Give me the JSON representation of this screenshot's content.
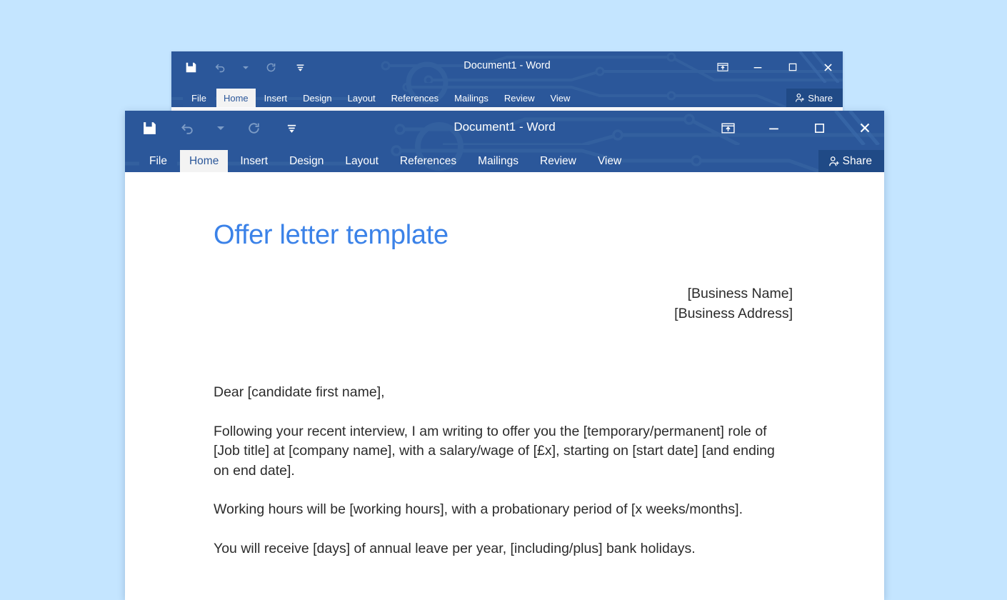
{
  "desktop": {
    "background_color": "#c4e5ff"
  },
  "theme": {
    "titlebar_color": "#2b579a",
    "active_tab_bg": "#f3f3f3",
    "active_tab_text": "#2b579a",
    "share_button_bg": "#204a86",
    "heading_color": "#3b82e8",
    "body_text_color": "#2b2b2b"
  },
  "back_window": {
    "title": "Document1 - Word",
    "quick_access": [
      {
        "name": "save-icon",
        "label": "Save",
        "enabled": true
      },
      {
        "name": "undo-icon",
        "label": "Undo",
        "enabled": false
      },
      {
        "name": "undo-dropdown-icon",
        "label": "Undo options",
        "enabled": false
      },
      {
        "name": "redo-icon",
        "label": "Redo",
        "enabled": false
      },
      {
        "name": "customize-quick-access-icon",
        "label": "Customize Quick Access Toolbar",
        "enabled": true
      }
    ],
    "window_controls": [
      {
        "name": "ribbon-display-options-icon",
        "label": "Ribbon Display Options"
      },
      {
        "name": "minimize-icon",
        "label": "Minimize"
      },
      {
        "name": "restore-icon",
        "label": "Restore Down"
      },
      {
        "name": "close-icon",
        "label": "Close"
      }
    ],
    "tabs": [
      {
        "label": "File",
        "active": false,
        "is_file": true
      },
      {
        "label": "Home",
        "active": true,
        "is_file": false
      },
      {
        "label": "Insert",
        "active": false,
        "is_file": false
      },
      {
        "label": "Design",
        "active": false,
        "is_file": false
      },
      {
        "label": "Layout",
        "active": false,
        "is_file": false
      },
      {
        "label": "References",
        "active": false,
        "is_file": false
      },
      {
        "label": "Mailings",
        "active": false,
        "is_file": false
      },
      {
        "label": "Review",
        "active": false,
        "is_file": false
      },
      {
        "label": "View",
        "active": false,
        "is_file": false
      }
    ],
    "share_label": "Share"
  },
  "front_window": {
    "title": "Document1 - Word",
    "quick_access": [
      {
        "name": "save-icon",
        "label": "Save",
        "enabled": true
      },
      {
        "name": "undo-icon",
        "label": "Undo",
        "enabled": false
      },
      {
        "name": "undo-dropdown-icon",
        "label": "Undo options",
        "enabled": false
      },
      {
        "name": "redo-icon",
        "label": "Redo",
        "enabled": false
      },
      {
        "name": "customize-quick-access-icon",
        "label": "Customize Quick Access Toolbar",
        "enabled": true
      }
    ],
    "window_controls": [
      {
        "name": "ribbon-display-options-icon",
        "label": "Ribbon Display Options"
      },
      {
        "name": "minimize-icon",
        "label": "Minimize"
      },
      {
        "name": "restore-icon",
        "label": "Restore Down"
      },
      {
        "name": "close-icon",
        "label": "Close"
      }
    ],
    "tabs": [
      {
        "label": "File",
        "active": false,
        "is_file": true
      },
      {
        "label": "Home",
        "active": true,
        "is_file": false
      },
      {
        "label": "Insert",
        "active": false,
        "is_file": false
      },
      {
        "label": "Design",
        "active": false,
        "is_file": false
      },
      {
        "label": "Layout",
        "active": false,
        "is_file": false
      },
      {
        "label": "References",
        "active": false,
        "is_file": false
      },
      {
        "label": "Mailings",
        "active": false,
        "is_file": false
      },
      {
        "label": "Review",
        "active": false,
        "is_file": false
      },
      {
        "label": "View",
        "active": false,
        "is_file": false
      }
    ],
    "share_label": "Share"
  },
  "document": {
    "heading": "Offer letter template",
    "address_lines": [
      "[Business Name]",
      "[Business Address]"
    ],
    "paragraphs": [
      "Dear [candidate first name],",
      "Following your recent interview, I am writing to offer you the [temporary/permanent] role of [Job title] at [company name], with a salary/wage of [£x], starting on [start date] [and ending on end date].",
      "Working hours will be [working hours], with a probationary period of [x weeks/months].",
      "You will receive [days] of annual leave per year, [including/plus] bank holidays."
    ]
  }
}
